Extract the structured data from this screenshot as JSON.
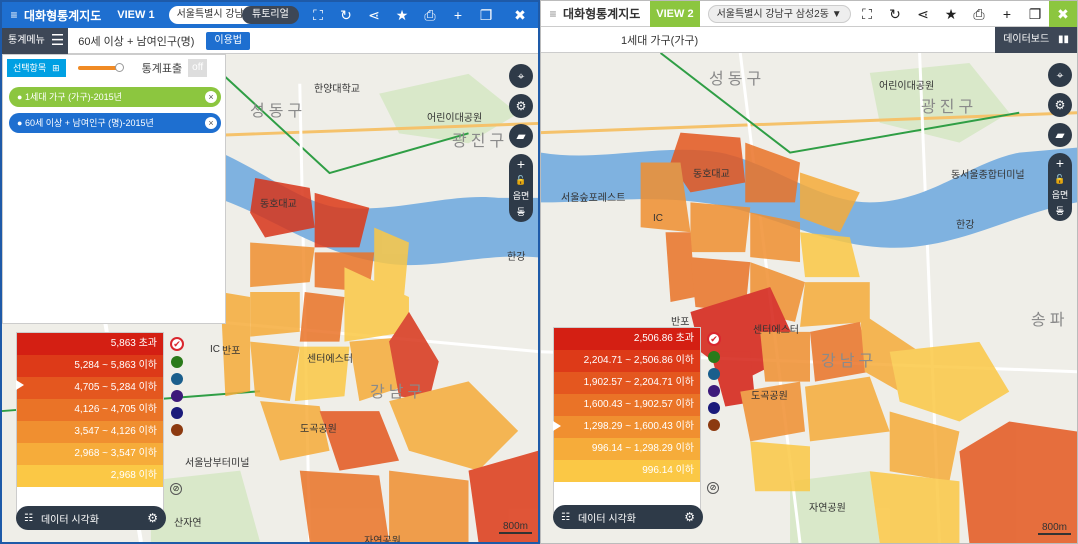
{
  "left": {
    "app_title": "대화형통계지도",
    "view_label": "VIEW 1",
    "region": "서울특별시 강남구 논",
    "tutorial": "튜토리얼",
    "stat_menu": "통계메뉴",
    "subtitle": "60세 이상 + 남여인구(명)",
    "usage_btn": "이용법",
    "select_items": "선택항목",
    "stat_table_label": "통계표출",
    "toggle": "off",
    "chips": [
      {
        "label": "1세대 가구 (가구)-2015년",
        "color": "#8cc63f"
      },
      {
        "label": "60세 이상 + 남여인구 (명)-2015년",
        "color": "#1e6fd0"
      }
    ],
    "legend": [
      {
        "label": "5,863 초과",
        "color": "#d41f13"
      },
      {
        "label": "5,284 ~ 5,863 이하",
        "color": "#dd3a18"
      },
      {
        "label": "4,705 ~ 5,284 이하",
        "color": "#e4571f"
      },
      {
        "label": "4,126 ~ 4,705 이하",
        "color": "#ea7327"
      },
      {
        "label": "3,547 ~ 4,126 이하",
        "color": "#f08f30"
      },
      {
        "label": "2,968 ~ 3,547 이하",
        "color": "#f6ac3a"
      },
      {
        "label": "2,968 이하",
        "color": "#fbc845"
      }
    ],
    "viz": "데이터 시각화",
    "zoom_label": "읍면동",
    "scale": "800m",
    "map_labels": [
      "성동구",
      "광진구",
      "한양대학교",
      "어린이대공원",
      "동호대교",
      "반포",
      "센터에스터",
      "강남구",
      "도곡공원",
      "서울남부터미널",
      "산자연",
      "자연공원",
      "한강",
      "IC"
    ]
  },
  "right": {
    "app_title": "대화형통계지도",
    "view_label": "VIEW 2",
    "region": "서울특별시 강남구 삼성2동",
    "subtitle": "1세대 가구(가구)",
    "dashboard": "데이터보드",
    "legend": [
      {
        "label": "2,506.86 초과",
        "color": "#d41f13"
      },
      {
        "label": "2,204.71 ~ 2,506.86 이하",
        "color": "#dd3a18"
      },
      {
        "label": "1,902.57 ~ 2,204.71 이하",
        "color": "#e4571f"
      },
      {
        "label": "1,600.43 ~ 1,902.57 이하",
        "color": "#ea7327"
      },
      {
        "label": "1,298.29 ~ 1,600.43 이하",
        "color": "#f08f30"
      },
      {
        "label": "996.14 ~ 1,298.29 이하",
        "color": "#f6ac3a"
      },
      {
        "label": "996.14 이하",
        "color": "#fbc845"
      }
    ],
    "viz": "데이터 시각화",
    "zoom_label": "읍면동",
    "scale": "800m",
    "map_labels": [
      "성동구",
      "광진구",
      "어린이대공원",
      "동호대교",
      "서울숲포레스트",
      "반포",
      "센터에스터",
      "강남구",
      "도곡공원",
      "송파",
      "동서울종합터미널",
      "한강",
      "자연공원",
      "IC"
    ]
  },
  "legend_dot_colors": [
    "#2a7a1a",
    "#1a5e8c",
    "#3d1a7a",
    "#1a1a7a",
    "#8c3a10"
  ]
}
